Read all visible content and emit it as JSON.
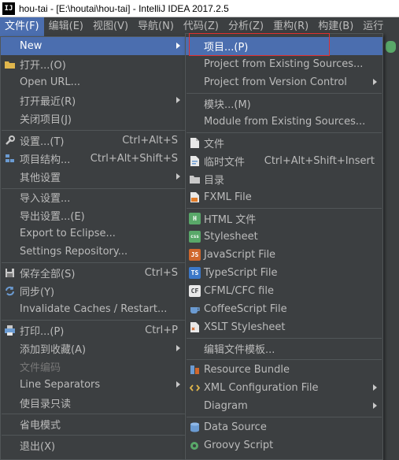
{
  "window": {
    "title": "hou-tai - [E:\\houtai\\hou-tai] - IntelliJ IDEA 2017.2.5"
  },
  "menubar": {
    "items": [
      "文件(F)",
      "编辑(E)",
      "视图(V)",
      "导航(N)",
      "代码(Z)",
      "分析(Z)",
      "重构(R)",
      "构建(B)",
      "运行"
    ]
  },
  "file_menu": {
    "new": "New",
    "open": "打开...(O)",
    "open_url": "Open URL...",
    "open_recent": "打开最近(R)",
    "close_project": "关闭项目(J)",
    "settings": "设置...(T)",
    "settings_shortcut": "Ctrl+Alt+S",
    "project_structure": "项目结构...",
    "project_structure_shortcut": "Ctrl+Alt+Shift+S",
    "other_settings": "其他设置",
    "import_settings": "导入设置...",
    "export_settings": "导出设置...(E)",
    "export_eclipse": "Export to Eclipse...",
    "settings_repo": "Settings Repository...",
    "save_all": "保存全部(S)",
    "save_all_shortcut": "Ctrl+S",
    "sync": "同步(Y)",
    "invalidate": "Invalidate Caches / Restart...",
    "print": "打印...(P)",
    "print_shortcut": "Ctrl+P",
    "add_favorites": "添加到收藏(A)",
    "file_encoding": "文件编码",
    "line_separators": "Line Separators",
    "make_readonly": "使目录只读",
    "power_save": "省电模式",
    "exit": "退出(X)"
  },
  "new_submenu": {
    "project": "项目...(P)",
    "project_existing": "Project from Existing Sources...",
    "project_vcs": "Project from Version Control",
    "module": "模块...(M)",
    "module_existing": "Module from Existing Sources...",
    "file": "文件",
    "scratch": "临时文件",
    "scratch_shortcut": "Ctrl+Alt+Shift+Insert",
    "directory": "目录",
    "fxml": "FXML File",
    "html": "HTML 文件",
    "stylesheet": "Stylesheet",
    "javascript": "JavaScript File",
    "typescript": "TypeScript File",
    "cfml": "CFML/CFC file",
    "coffeescript": "CoffeeScript File",
    "xslt": "XSLT Stylesheet",
    "edit_templates": "编辑文件模板...",
    "resource_bundle": "Resource Bundle",
    "xml_config": "XML Configuration File",
    "diagram": "Diagram",
    "data_source": "Data Source",
    "groovy": "Groovy Script"
  },
  "colors": {
    "highlight": "#4b6eaf",
    "menu_bg": "#3c3f41",
    "annotation": "#e03030"
  }
}
